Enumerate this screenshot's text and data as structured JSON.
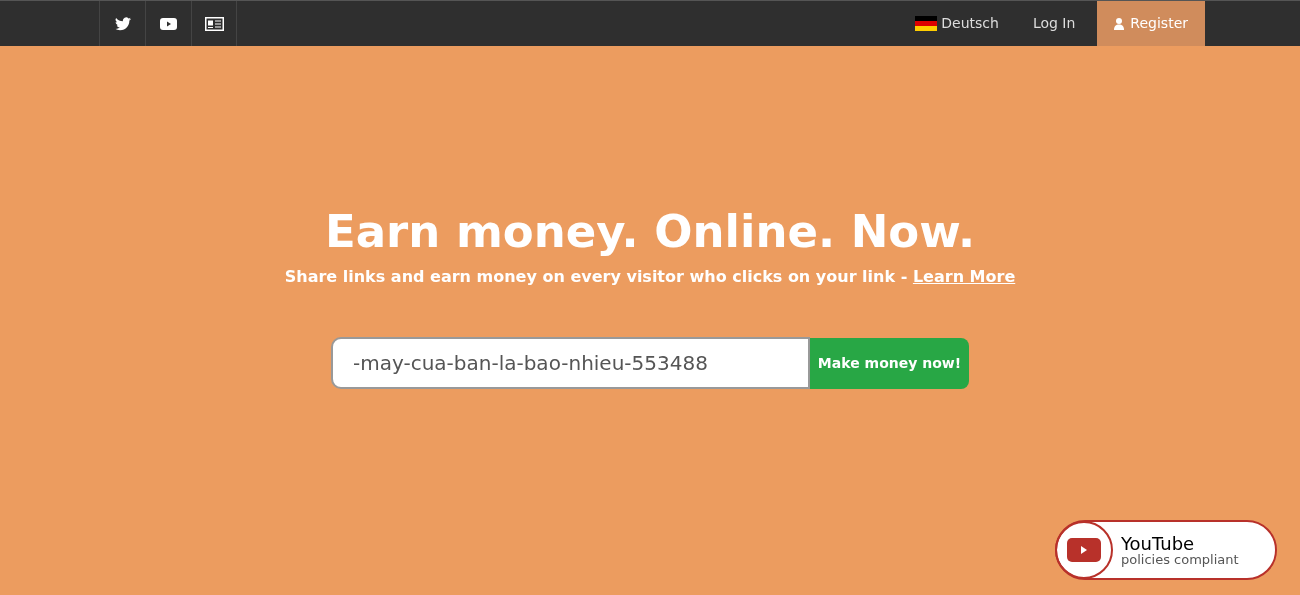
{
  "nav": {
    "language": "Deutsch",
    "login": "Log In",
    "register": "Register"
  },
  "hero": {
    "title": "Earn money. Online. Now.",
    "subtitle": "Share links and earn money on every visitor who clicks on your link - ",
    "learn_more": "Learn More"
  },
  "form": {
    "value": "-may-cua-ban-la-bao-nhieu-553488",
    "button": "Make money now!"
  },
  "badge": {
    "title": "YouTube",
    "subtitle": "policies compliant"
  }
}
